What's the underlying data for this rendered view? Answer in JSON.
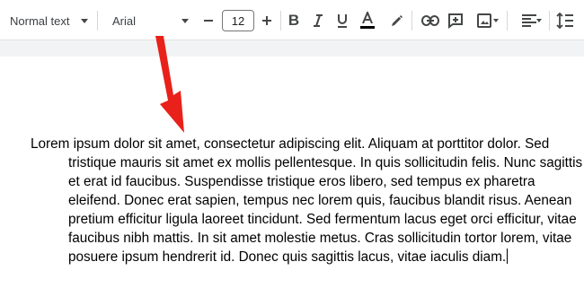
{
  "toolbar": {
    "paragraph_style": "Normal text",
    "font_family": "Arial",
    "font_size": "12",
    "icons": [
      "chevron-down-icon",
      "minus-icon",
      "plus-icon",
      "bold-icon",
      "italic-icon",
      "underline-icon",
      "text-color-icon",
      "highlight-icon",
      "link-icon",
      "comment-icon",
      "image-icon",
      "align-icon",
      "line-spacing-icon"
    ],
    "text_color_underline": "#000000"
  },
  "document": {
    "paragraph": "Lorem ipsum dolor sit amet, consectetur adipiscing elit. Aliquam at porttitor dolor. Sed tristique mauris sit amet ex mollis pellentesque. In quis sollicitudin felis. Nunc sagittis et erat id faucibus. Suspendisse tristique eros libero, sed tempus ex pharetra eleifend. Donec erat sapien, tempus nec lorem quis, faucibus blandit risus. Aenean pretium efficitur ligula laoreet tincidunt. Sed fermentum lacus eget orci efficitur, vitae faucibus nibh mattis. In sit amet molestie metus. Cras sollicitudin tortor lorem, vitae posuere ipsum hendrerit id. Donec quis sagittis lacus, vitae iaculis diam."
  },
  "annotation": {
    "arrow_color": "#e8211a"
  }
}
